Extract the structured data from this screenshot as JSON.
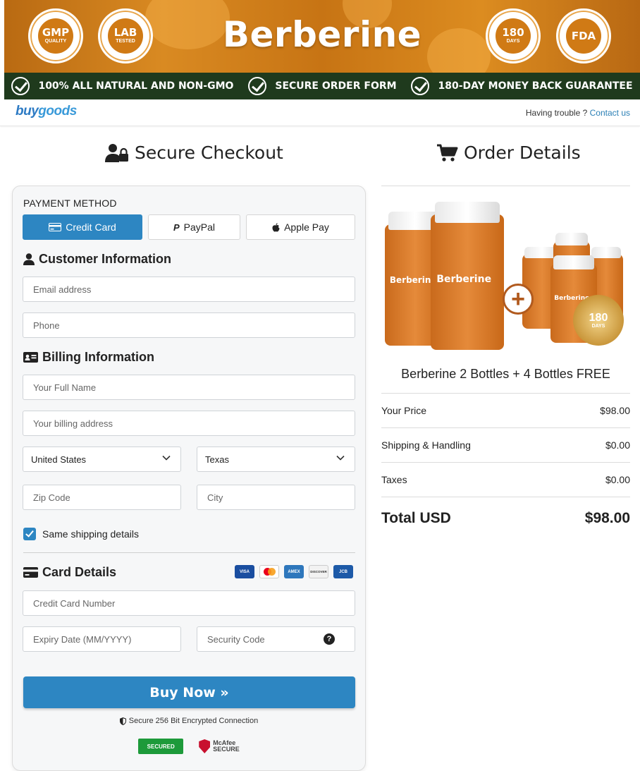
{
  "banner": {
    "title": "Berberine",
    "seals": [
      {
        "main": "GMP",
        "sub": "QUALITY"
      },
      {
        "main": "LAB",
        "sub": "TESTED"
      },
      {
        "main": "180",
        "sub": "DAYS"
      },
      {
        "main": "FDA",
        "sub": ""
      }
    ],
    "features": [
      "100% ALL NATURAL AND NON-GMO",
      "SECURE ORDER FORM",
      "180-DAY MONEY BACK GUARANTEE"
    ]
  },
  "topbar": {
    "logo_buy": "buy",
    "logo_goods": "goods",
    "trouble_text": "Having trouble ?",
    "contact_link": "Contact us"
  },
  "checkout": {
    "title": "Secure Checkout",
    "payment_method_label": "PAYMENT METHOD",
    "payment_methods": [
      "Credit Card",
      "PayPal",
      "Apple Pay"
    ],
    "customer_info_title": "Customer Information",
    "email_placeholder": "Email address",
    "phone_placeholder": "Phone",
    "billing_info_title": "Billing Information",
    "fullname_placeholder": "Your Full Name",
    "address_placeholder": "Your billing address",
    "country_value": "United States",
    "state_value": "Texas",
    "zip_placeholder": "Zip Code",
    "city_placeholder": "City",
    "same_shipping_label": "Same shipping details",
    "card_details_title": "Card Details",
    "card_brands": [
      "VISA",
      "MC",
      "AMEX",
      "DISCOVER",
      "JCB"
    ],
    "card_number_placeholder": "Credit Card Number",
    "expiry_placeholder": "Expiry Date (MM/YYYY)",
    "security_code_placeholder": "Security Code",
    "buy_button": "Buy Now »",
    "secure_note": "Secure 256 Bit Encrypted Connection",
    "trust_badge": "SECURED",
    "mcafee_badge_1": "McAfee",
    "mcafee_badge_2": "SECURE"
  },
  "order": {
    "title": "Order Details",
    "bottle_label": "Berberine",
    "seal_days": "180",
    "seal_text": "DAYS",
    "product_name": "Berberine 2 Bottles + 4 Bottles FREE",
    "rows": [
      {
        "label": "Your Price",
        "value": "$98.00"
      },
      {
        "label": "Shipping & Handling",
        "value": "$0.00"
      },
      {
        "label": "Taxes",
        "value": "$0.00"
      }
    ],
    "total_label": "Total USD",
    "total_value": "$98.00"
  },
  "colors": {
    "accent": "#2d86c2",
    "banner_orange": "#d07a15",
    "banner_bar": "#1f3a1d"
  }
}
